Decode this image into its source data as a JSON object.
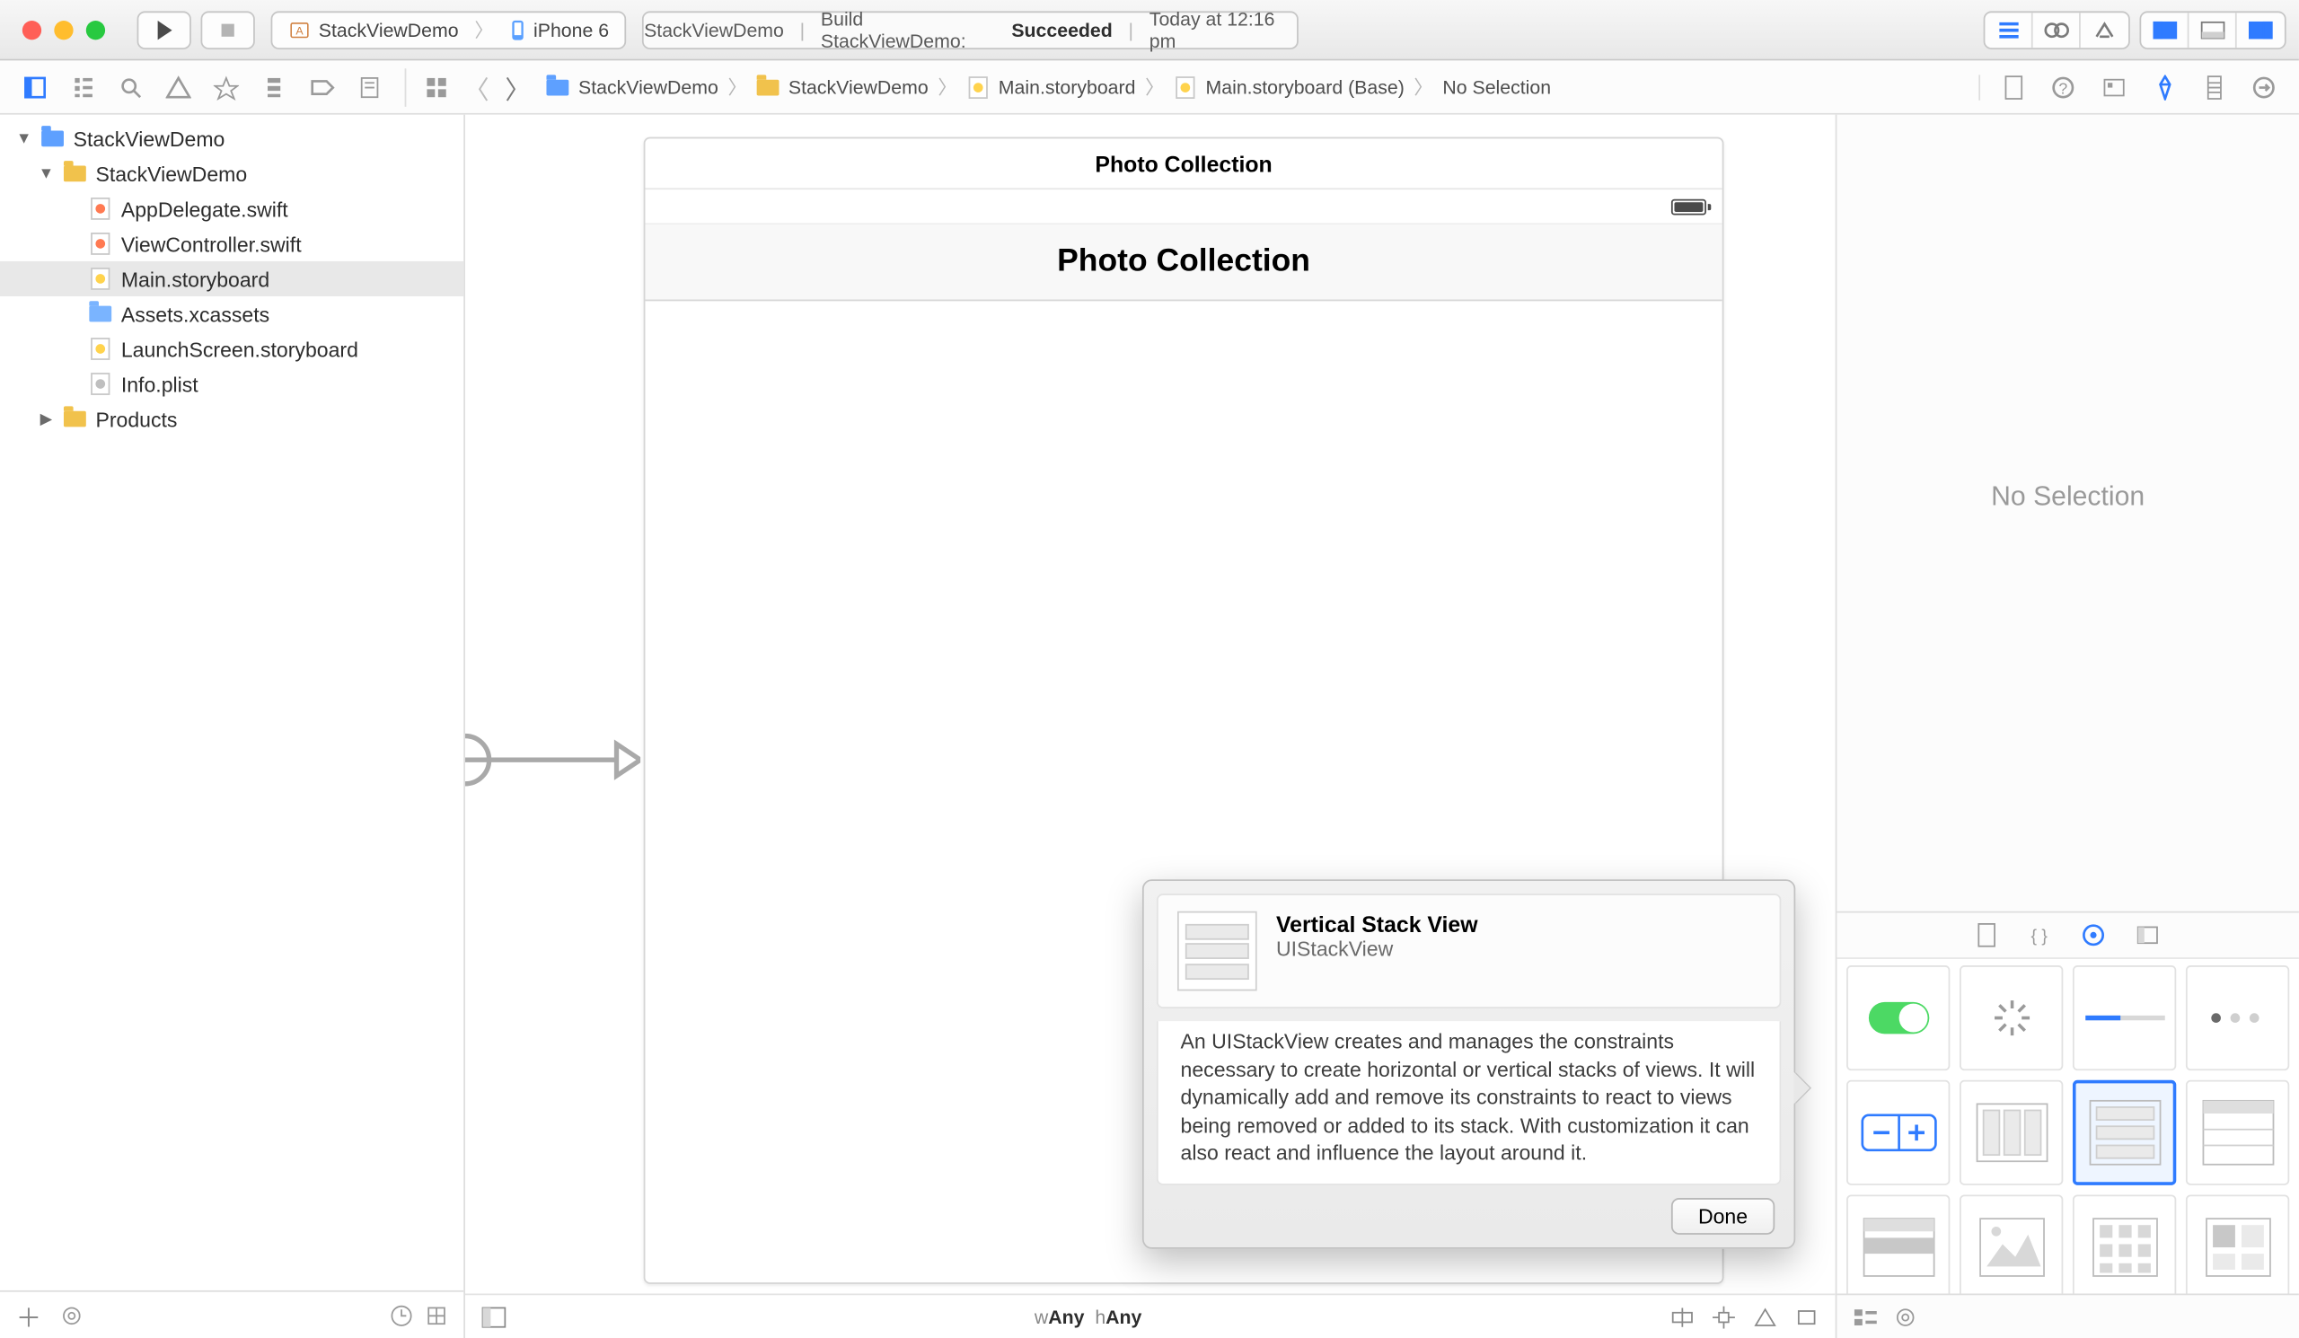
{
  "titlebar": {
    "scheme_target": "StackViewDemo",
    "scheme_device": "iPhone 6",
    "activity_project": "StackViewDemo",
    "activity_action": "Build StackViewDemo:",
    "activity_status": "Succeeded",
    "activity_time": "Today at 12:16 pm"
  },
  "breadcrumb": {
    "items": [
      "StackViewDemo",
      "StackViewDemo",
      "Main.storyboard",
      "Main.storyboard (Base)",
      "No Selection"
    ]
  },
  "tree": {
    "items": [
      {
        "level": 0,
        "disc": "▼",
        "kind": "proj",
        "label": "StackViewDemo"
      },
      {
        "level": 1,
        "disc": "▼",
        "kind": "folder-gold",
        "label": "StackViewDemo"
      },
      {
        "level": 2,
        "disc": "",
        "kind": "swift",
        "label": "AppDelegate.swift"
      },
      {
        "level": 2,
        "disc": "",
        "kind": "swift",
        "label": "ViewController.swift"
      },
      {
        "level": 2,
        "disc": "",
        "kind": "storyboard",
        "label": "Main.storyboard",
        "selected": true
      },
      {
        "level": 2,
        "disc": "",
        "kind": "folder-blue",
        "label": "Assets.xcassets"
      },
      {
        "level": 2,
        "disc": "",
        "kind": "storyboard",
        "label": "LaunchScreen.storyboard"
      },
      {
        "level": 2,
        "disc": "",
        "kind": "plist",
        "label": "Info.plist"
      },
      {
        "level": 1,
        "disc": "▶",
        "kind": "folder-gold",
        "label": "Products"
      }
    ]
  },
  "scene": {
    "scene_title": "Photo Collection",
    "navbar_title": "Photo Collection"
  },
  "size_class": {
    "w_label": "w",
    "w_val": "Any",
    "h_label": "h",
    "h_val": "Any"
  },
  "popover": {
    "title": "Vertical Stack View",
    "subtitle": "UIStackView",
    "body": "An UIStackView creates and manages the constraints necessary to create horizontal or vertical stacks of views. It will dynamically add and remove its constraints to react to views being removed or added to its stack. With customization it can also react and influence the layout around it.",
    "done": "Done"
  },
  "inspector": {
    "empty": "No Selection"
  }
}
